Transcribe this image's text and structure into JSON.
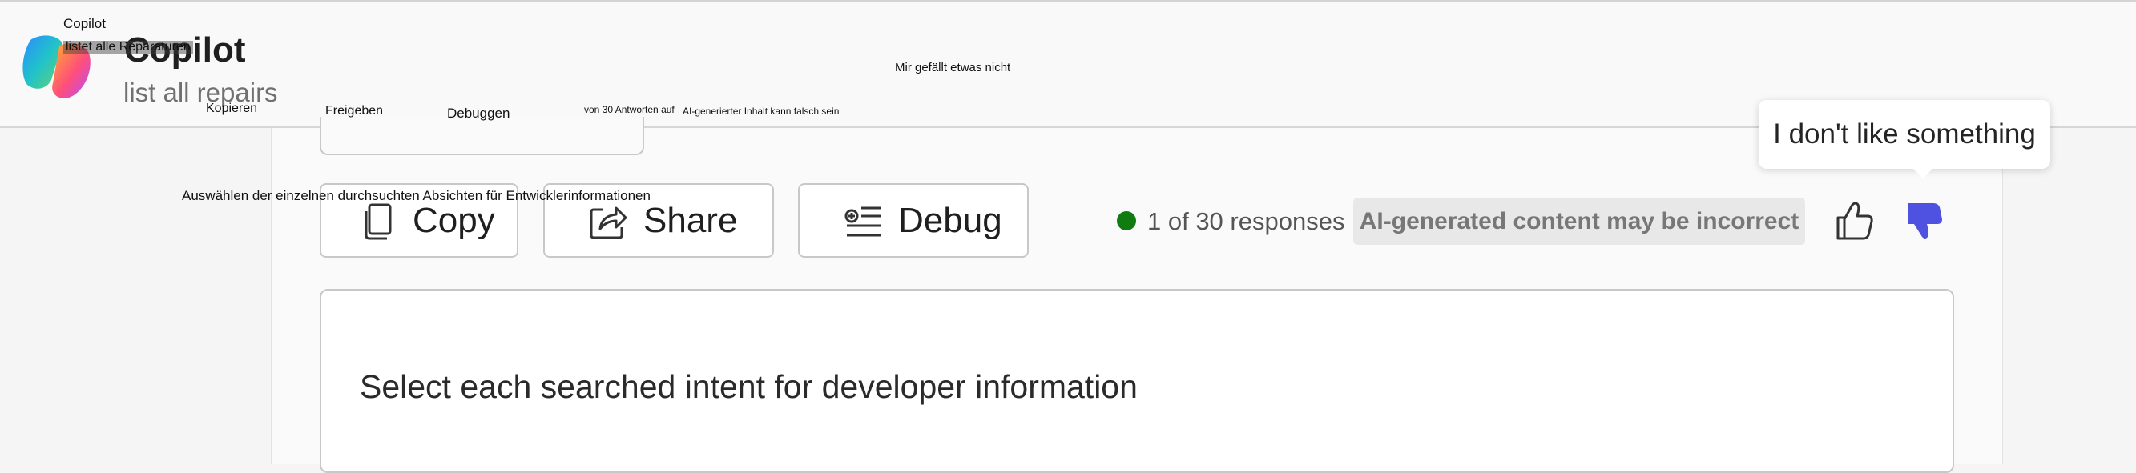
{
  "header": {
    "title": "Copilot",
    "subtitle": "list all repairs",
    "logo_icon": "copilot-logo-icon"
  },
  "overlay": {
    "title": "Copilot",
    "subtitle": "listet alle Reparaturen",
    "copy": "Kopieren",
    "share": "Freigeben",
    "debug": "Debuggen",
    "count": "von 30 Antworten auf",
    "ai_notice": "AI-generierter Inhalt kann falsch sein",
    "dislike": "Mir gefällt etwas nicht",
    "intent": "Auswählen der einzelnen durchsuchten Absichten für Entwicklerinformationen"
  },
  "toolbar": {
    "copy_label": "Copy",
    "share_label": "Share",
    "debug_label": "Debug",
    "copy_icon": "copy-icon",
    "share_icon": "share-icon",
    "debug_icon": "debug-icon"
  },
  "status": {
    "count_text": "1 of 30 responses",
    "ai_notice": "AI-generated content may be incorrect"
  },
  "feedback": {
    "like_icon": "thumbs-up-icon",
    "dislike_icon": "thumbs-down-icon",
    "tooltip": "I don't like something"
  },
  "intent": {
    "text": "Select each searched intent for developer information"
  },
  "colors": {
    "status_dot": "#107c10",
    "dislike_active": "#4f52e0",
    "badge_bg": "#e8e8e8"
  }
}
